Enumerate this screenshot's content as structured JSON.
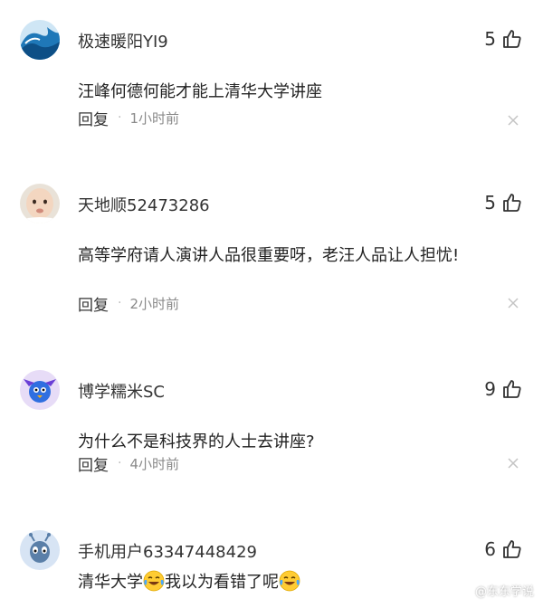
{
  "comments": [
    {
      "username": "极速暖阳YI9",
      "likes": "5",
      "text": "汪峰何德何能才能上清华大学讲座",
      "reply": "回复",
      "time": "1小时前",
      "avatar": "wave-avatar"
    },
    {
      "username": "天地顺52473286",
      "likes": "5",
      "text": "高等学府请人演讲人品很重要呀，老汪人品让人担忧!",
      "reply": "回复",
      "time": "2小时前",
      "avatar": "baby-avatar"
    },
    {
      "username": "博学糯米SC",
      "likes": "9",
      "text": "为什么不是科技界的人士去讲座?",
      "reply": "回复",
      "time": "4小时前",
      "avatar": "blue-bird-avatar"
    },
    {
      "username": "手机用户63347448429",
      "likes": "6",
      "text_part1": "清华大学",
      "text_part2": "我以为看错了呢",
      "emoji": "laughing-crying-emoji",
      "avatar": "alien-avatar"
    }
  ],
  "watermark": "@东东学说",
  "colors": {
    "text": "#222222",
    "muted": "#8a8a8a",
    "background": "#ffffff"
  }
}
